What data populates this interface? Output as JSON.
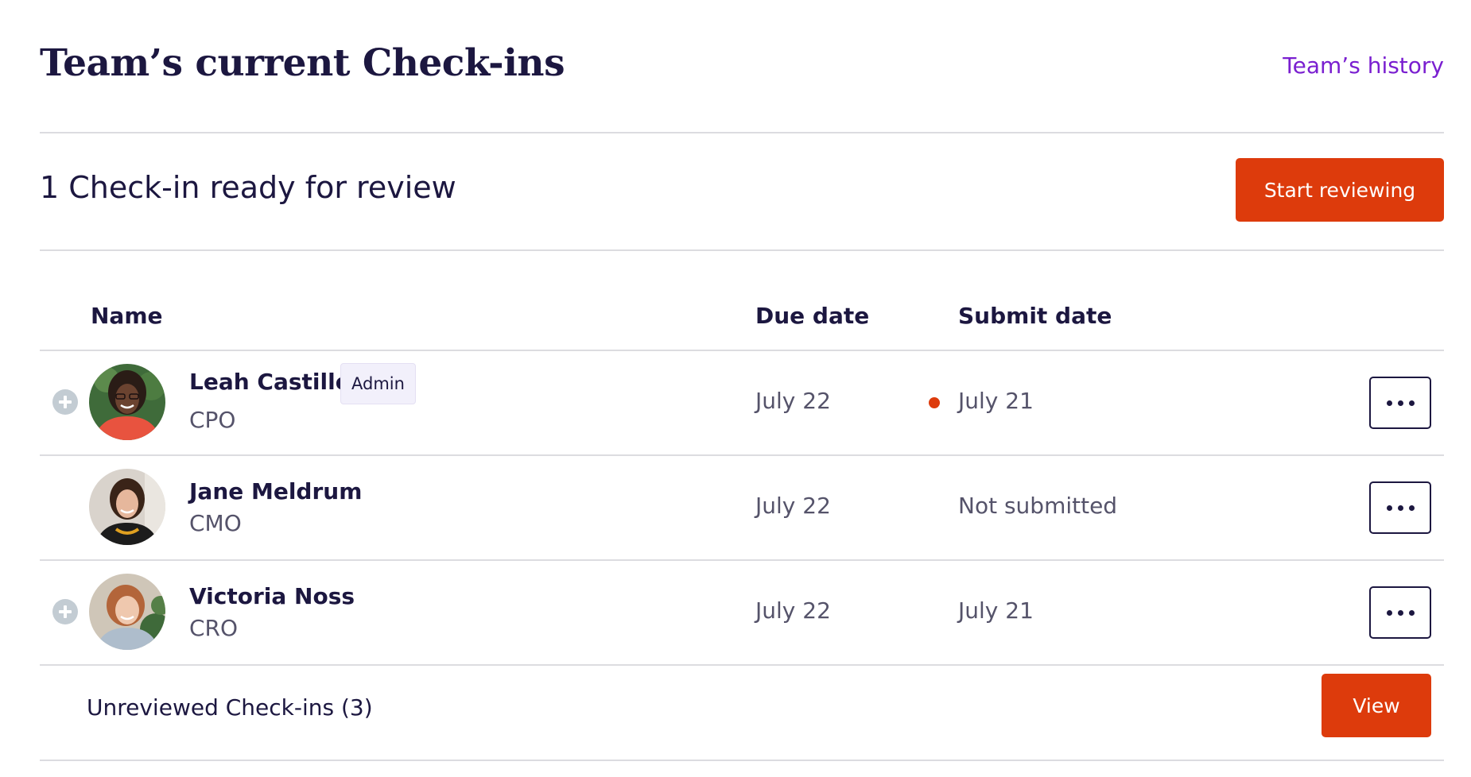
{
  "header": {
    "title": "Team’s current Check-ins",
    "history_link": "Team’s history"
  },
  "review": {
    "ready_text": "1 Check-in ready for review",
    "start_button": "Start reviewing"
  },
  "table": {
    "columns": {
      "name": "Name",
      "due_date": "Due date",
      "submit_date": "Submit date"
    },
    "rows": [
      {
        "name": "Leah Castillo",
        "badge": "Admin",
        "role": "CPO",
        "due_date": "July 22",
        "submit_date": "July 21",
        "has_expand": true,
        "has_status_dot": true
      },
      {
        "name": "Jane Meldrum",
        "role": "CMO",
        "due_date": "July 22",
        "submit_date": "Not submitted",
        "has_expand": false,
        "has_status_dot": false
      },
      {
        "name": "Victoria Noss",
        "role": "CRO",
        "due_date": "July 22",
        "submit_date": "July 21",
        "has_expand": true,
        "has_status_dot": false
      }
    ]
  },
  "footer": {
    "unreviewed_label": "Unreviewed Check-ins (3)",
    "view_button": "View"
  },
  "colors": {
    "primary_button": "#dd3b0c",
    "link": "#7a1fd0",
    "text_dark": "#1c1740",
    "text_muted": "#55536a",
    "divider": "#dcdce0",
    "status_dot": "#dd3b0c"
  },
  "icons": {
    "expand": "plus-circle-icon",
    "more": "more-horizontal-icon",
    "status": "status-dot-icon"
  }
}
